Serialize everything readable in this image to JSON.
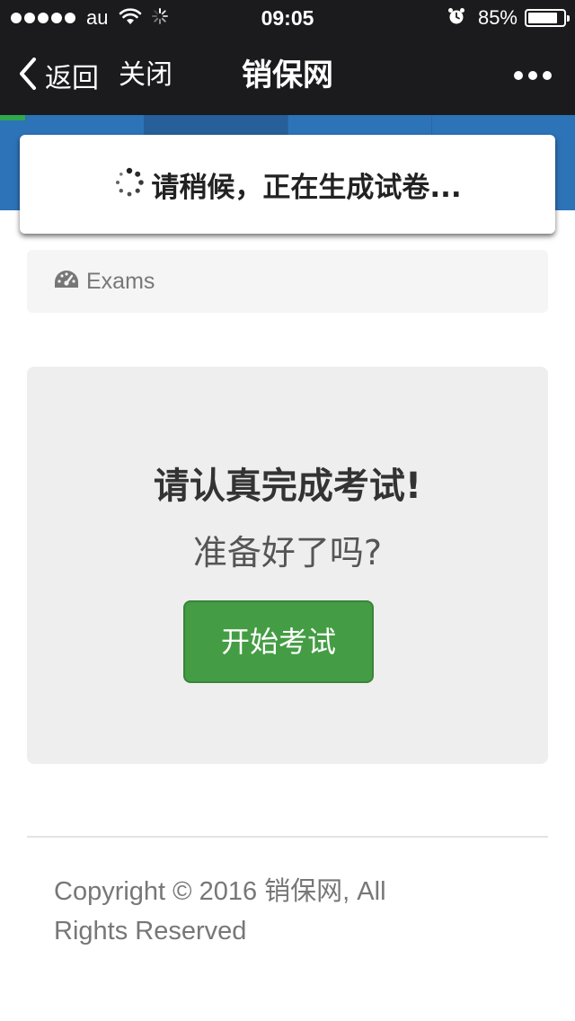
{
  "status_bar": {
    "carrier": "au",
    "time": "09:05",
    "battery_percent": "85%",
    "battery_level": 0.85,
    "signal_bars": 5
  },
  "nav_bar": {
    "back_label": "返回",
    "close_label": "关闭",
    "title": "销保网"
  },
  "loading": {
    "message": "请稍候，正在生成试卷..."
  },
  "breadcrumb": {
    "icon": "dashboard-icon",
    "label": "Exams"
  },
  "exam": {
    "heading": "请认真完成考试!",
    "subheading": "准备好了吗?",
    "start_button": "开始考试"
  },
  "footer": {
    "copyright": "Copyright © 2016 销保网, All Rights Reserved"
  },
  "colors": {
    "nav_background": "#1b1b1d",
    "header_blue": "#2d73b7",
    "progress_green": "#2fa84f",
    "button_green": "#449d44"
  }
}
